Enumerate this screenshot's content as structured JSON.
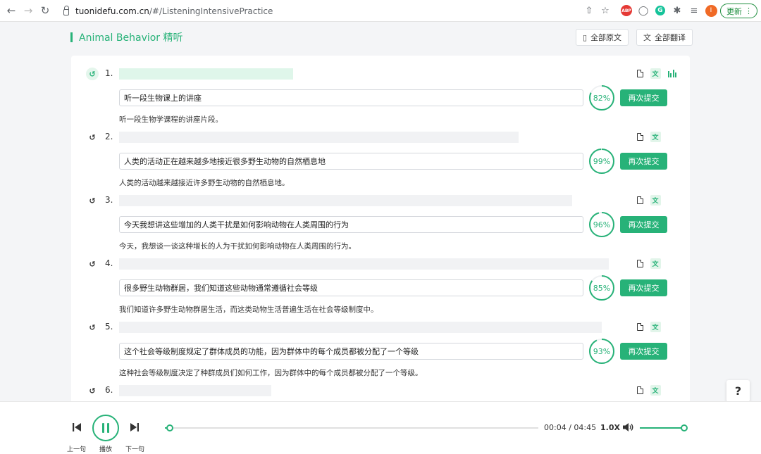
{
  "browser": {
    "back_icon": "arrow-left-icon",
    "forward_icon": "arrow-right-icon",
    "reload_icon": "reload-icon",
    "url_host": "tuonidefu.com.cn",
    "url_path": "/#/ListeningIntensivePractice",
    "abp_label": "ABP",
    "grammarly_label": "G",
    "profile_initial": "I",
    "update_label": "更新"
  },
  "header": {
    "title": "Animal Behavior 精听",
    "show_original_label": "全部原文",
    "show_translation_label": "全部翻译"
  },
  "accent_color": "#27b278",
  "items": [
    {
      "number": "1.",
      "answer": "听一段生物课上的讲座",
      "score": "82%",
      "score_value": 82,
      "submit_label": "再次提交",
      "translation": "听一段生物学课程的讲座片段。"
    },
    {
      "number": "2.",
      "answer": "人类的活动正在越来越多地接近很多野生动物的自然栖息地",
      "score": "99%",
      "score_value": 99,
      "submit_label": "再次提交",
      "translation": "人类的活动越来越接近许多野生动物的自然栖息地。"
    },
    {
      "number": "3.",
      "answer": "今天我想讲这些增加的人类干扰是如何影响动物在人类周围的行为",
      "score": "96%",
      "score_value": 96,
      "submit_label": "再次提交",
      "translation": "今天，我想谈一谈这种增长的人为干扰如何影响动物在人类周围的行为。"
    },
    {
      "number": "4.",
      "answer": "很多野生动物群居，我们知道这些动物通常遵循社会等级",
      "score": "85%",
      "score_value": 85,
      "submit_label": "再次提交",
      "translation": "我们知道许多野生动物群居生活，而这类动物生活普遍生活在社会等级制度中。"
    },
    {
      "number": "5.",
      "answer": "这个社会等级制度规定了群体成员的功能，因为群体中的每个成员都被分配了一个等级",
      "score": "93%",
      "score_value": 93,
      "submit_label": "再次提交",
      "translation": "这种社会等级制度决定了种群成员们如何工作，因为群体中的每个成员都被分配了一个等级。"
    },
    {
      "number": "6."
    }
  ],
  "help_label": "?",
  "player": {
    "prev_label": "上一句",
    "play_label": "播放",
    "next_label": "下一句",
    "time": "00:04 / 04:45",
    "speed": "1.0X",
    "progress_fraction": 0.014,
    "volume_fraction": 1.0
  }
}
